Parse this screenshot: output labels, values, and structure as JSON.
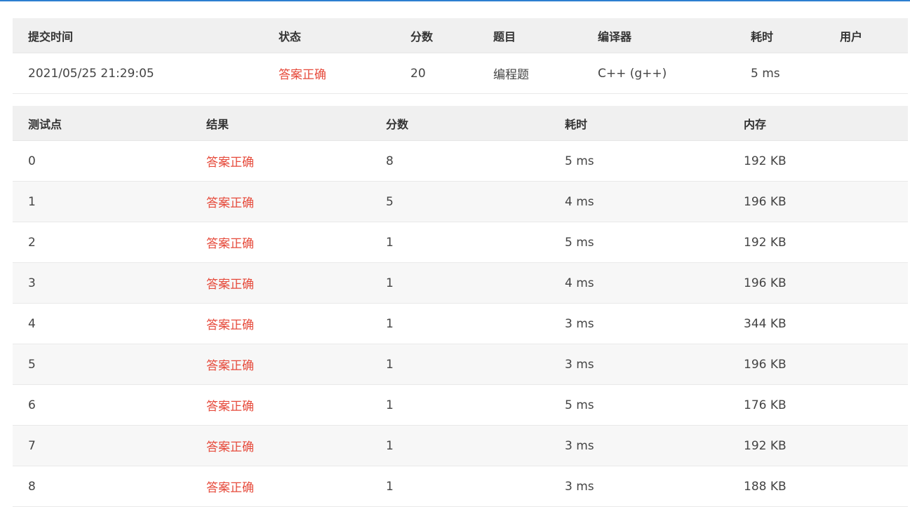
{
  "submission": {
    "headers": {
      "time": "提交时间",
      "status": "状态",
      "score": "分数",
      "problem": "题目",
      "compiler": "编译器",
      "duration": "耗时",
      "user": "用户"
    },
    "row": {
      "time": "2021/05/25 21:29:05",
      "status": "答案正确",
      "score": "20",
      "problem": "编程题",
      "compiler": "C++ (g++)",
      "duration": "5 ms",
      "user": ""
    }
  },
  "testcases": {
    "headers": {
      "case": "测试点",
      "result": "结果",
      "score": "分数",
      "duration": "耗时",
      "memory": "内存"
    },
    "rows": [
      {
        "case": "0",
        "result": "答案正确",
        "score": "8",
        "duration": "5 ms",
        "memory": "192 KB"
      },
      {
        "case": "1",
        "result": "答案正确",
        "score": "5",
        "duration": "4 ms",
        "memory": "196 KB"
      },
      {
        "case": "2",
        "result": "答案正确",
        "score": "1",
        "duration": "5 ms",
        "memory": "192 KB"
      },
      {
        "case": "3",
        "result": "答案正确",
        "score": "1",
        "duration": "4 ms",
        "memory": "196 KB"
      },
      {
        "case": "4",
        "result": "答案正确",
        "score": "1",
        "duration": "3 ms",
        "memory": "344 KB"
      },
      {
        "case": "5",
        "result": "答案正确",
        "score": "1",
        "duration": "3 ms",
        "memory": "196 KB"
      },
      {
        "case": "6",
        "result": "答案正确",
        "score": "1",
        "duration": "5 ms",
        "memory": "176 KB"
      },
      {
        "case": "7",
        "result": "答案正确",
        "score": "1",
        "duration": "3 ms",
        "memory": "192 KB"
      },
      {
        "case": "8",
        "result": "答案正确",
        "score": "1",
        "duration": "3 ms",
        "memory": "188 KB"
      }
    ]
  },
  "colors": {
    "accent_bar": "#2c7fd0",
    "status_ok": "#e64a3b",
    "header_bg": "#f0f0f0",
    "stripe_bg": "#f7f7f7"
  }
}
